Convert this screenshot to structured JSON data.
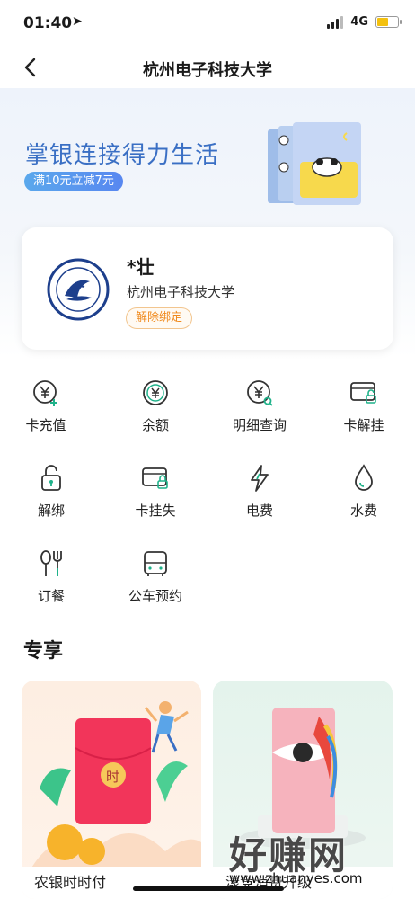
{
  "status": {
    "time": "01:40",
    "network": "4G"
  },
  "nav": {
    "title": "杭州电子科技大学",
    "back_icon": "chevron-left-icon"
  },
  "banner": {
    "title": "掌银连接得力生活",
    "promo": "满10元立减7元",
    "accent": "#3a6fc4"
  },
  "card": {
    "name": "*壮",
    "school": "杭州电子科技大学",
    "unbind_label": "解除绑定",
    "logo_text": "HANGZHOU DIANZI UNIVERSITY"
  },
  "functions": [
    {
      "label": "卡充值",
      "icon": "yuan-add-icon"
    },
    {
      "label": "余额",
      "icon": "yuan-circle-icon"
    },
    {
      "label": "明细查询",
      "icon": "yuan-search-icon"
    },
    {
      "label": "卡解挂",
      "icon": "card-unlock-icon"
    },
    {
      "label": "解绑",
      "icon": "unlock-icon"
    },
    {
      "label": "卡挂失",
      "icon": "card-lock-icon"
    },
    {
      "label": "电费",
      "icon": "lightning-icon"
    },
    {
      "label": "水费",
      "icon": "water-drop-icon"
    },
    {
      "label": "订餐",
      "icon": "fork-spoon-icon"
    },
    {
      "label": "公车预约",
      "icon": "bus-icon"
    }
  ],
  "exclusive": {
    "title": "专享",
    "cards": [
      {
        "label": "农银时时付",
        "badge": "时"
      },
      {
        "label": "漾竞消费升级"
      }
    ]
  },
  "watermark": {
    "big": "好赚网",
    "small": "www.zhuanyes.com"
  },
  "colors": {
    "icon_teal": "#1fb28a",
    "unbind_orange": "#f08a1e"
  }
}
